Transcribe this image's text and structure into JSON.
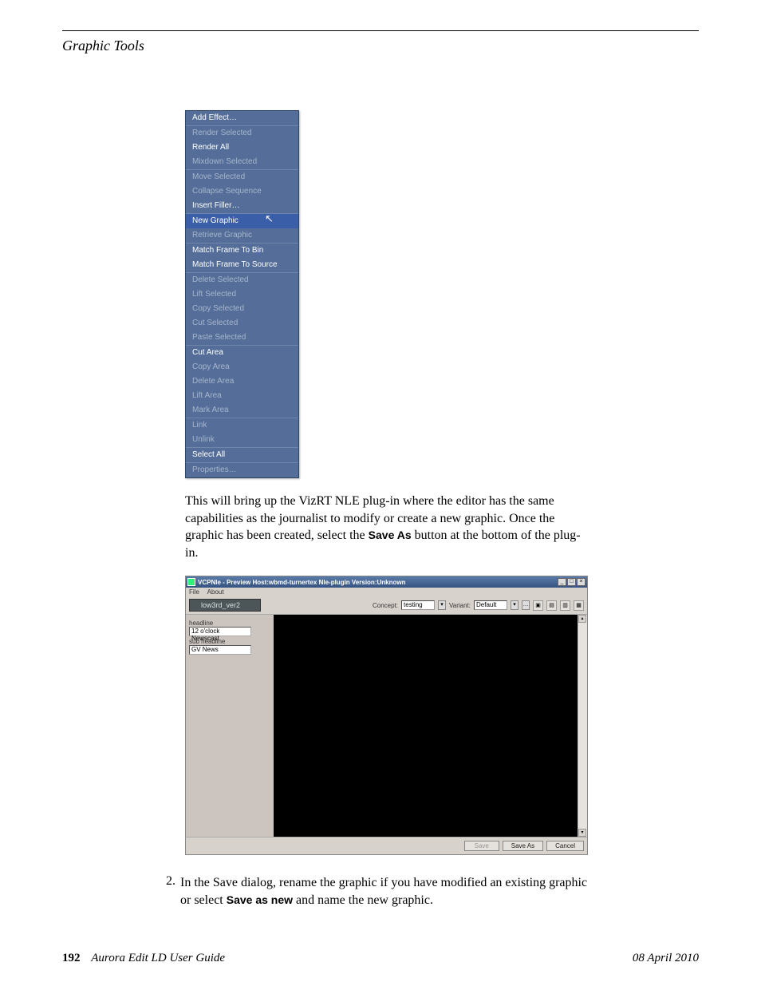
{
  "header": {
    "section_title": "Graphic Tools"
  },
  "context_menu": {
    "groups": [
      {
        "items": [
          {
            "label": "Add Effect…",
            "disabled": false
          }
        ]
      },
      {
        "items": [
          {
            "label": "Render Selected",
            "disabled": true
          },
          {
            "label": "Render All",
            "disabled": false
          },
          {
            "label": "Mixdown Selected",
            "disabled": true
          }
        ]
      },
      {
        "items": [
          {
            "label": "Move Selected",
            "disabled": true
          },
          {
            "label": "Collapse Sequence",
            "disabled": true
          },
          {
            "label": "Insert Filler…",
            "disabled": false
          }
        ]
      },
      {
        "items": [
          {
            "label": "New Graphic",
            "disabled": false,
            "highlighted": true
          },
          {
            "label": "Retrieve Graphic",
            "disabled": true
          }
        ]
      },
      {
        "items": [
          {
            "label": "Match Frame To Bin",
            "disabled": false
          },
          {
            "label": "Match Frame To Source",
            "disabled": false
          }
        ]
      },
      {
        "items": [
          {
            "label": "Delete Selected",
            "disabled": true
          },
          {
            "label": "Lift Selected",
            "disabled": true
          },
          {
            "label": "Copy Selected",
            "disabled": true
          },
          {
            "label": "Cut Selected",
            "disabled": true
          },
          {
            "label": "Paste Selected",
            "disabled": true
          }
        ]
      },
      {
        "items": [
          {
            "label": "Cut Area",
            "disabled": false
          },
          {
            "label": "Copy Area",
            "disabled": true
          },
          {
            "label": "Delete Area",
            "disabled": true
          },
          {
            "label": "Lift Area",
            "disabled": true
          },
          {
            "label": "Mark Area",
            "disabled": true
          }
        ]
      },
      {
        "items": [
          {
            "label": "Link",
            "disabled": true
          },
          {
            "label": "Unlink",
            "disabled": true
          }
        ]
      },
      {
        "items": [
          {
            "label": "Select All",
            "disabled": false
          }
        ]
      },
      {
        "items": [
          {
            "label": "Properties…",
            "disabled": true
          }
        ]
      }
    ]
  },
  "para1": {
    "pre": "This will bring up the VizRT NLE plug-in where the editor has the same capabilities as the journalist to modify or create a new graphic. Once the graphic has been created, select the ",
    "bold": "Save As",
    "post": " button at the bottom of the plug-in."
  },
  "plugin": {
    "title": "VCPNle - Preview Host:wbmd-turnertex Nle-plugin Version:Unknown",
    "menu_file": "File",
    "menu_about": "About",
    "template_name": "low3rd_ver2",
    "concept_label": "Concept:",
    "concept_value": "testing",
    "variant_label": "Variant:",
    "variant_value": "Default",
    "form": {
      "headline_label": "headline",
      "headline_value": "12 o'clock Newscast",
      "sub_headline_label": "sub headline",
      "sub_headline_value": "GV News"
    },
    "footer": {
      "save": "Save",
      "save_as": "Save As",
      "cancel": "Cancel"
    }
  },
  "step2": {
    "num": "2.",
    "pre": "In the Save dialog, rename the graphic if you have modified an existing graphic or select ",
    "bold": "Save as new",
    "post": " and name the new graphic."
  },
  "footer": {
    "page_number": "192",
    "doc_title": "Aurora Edit LD User Guide",
    "date": "08 April 2010"
  }
}
